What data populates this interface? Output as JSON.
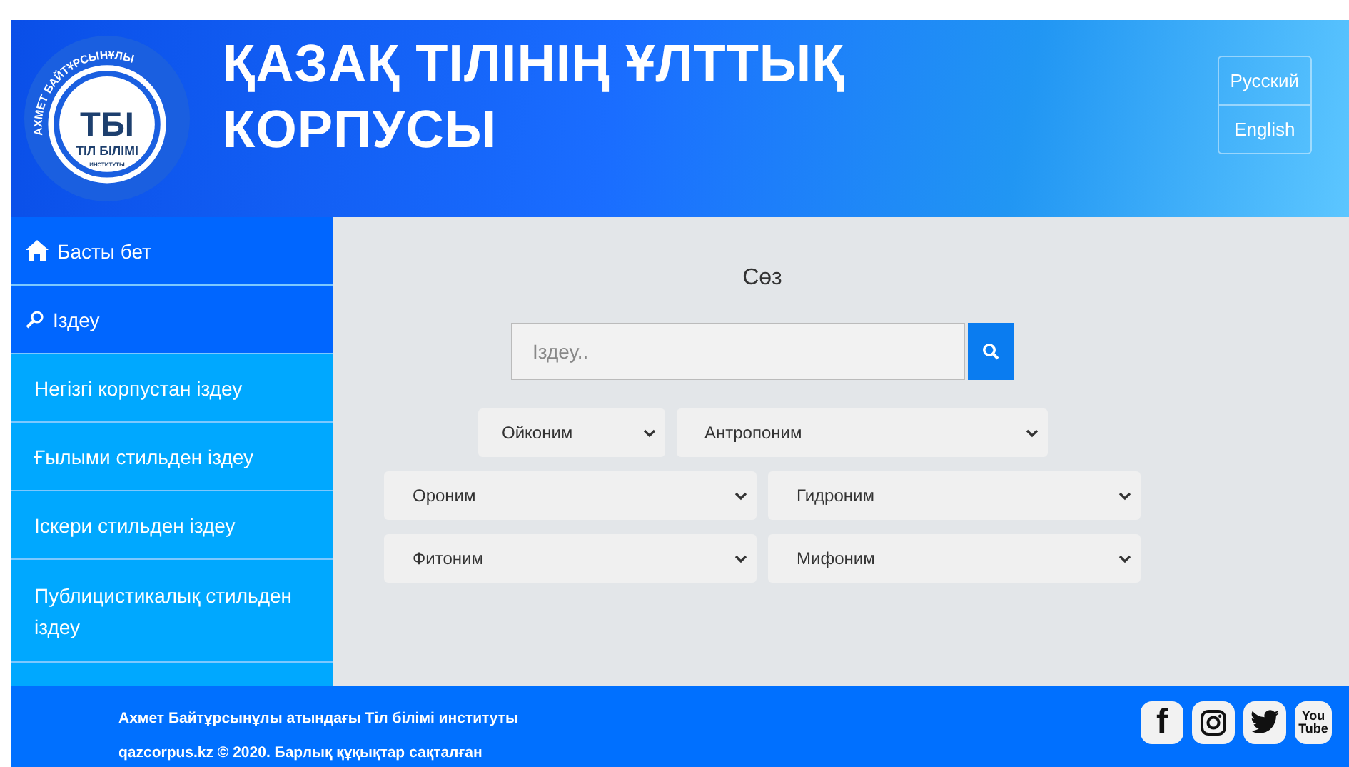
{
  "header": {
    "logo": {
      "arc_text": "АХМЕТ БАЙТҰРСЫНҰЛЫ",
      "mark": "ТБІ",
      "name": "ТІЛ БІЛІМІ",
      "subtitle": "ИНСТИТУТЫ"
    },
    "title": "ҚАЗАҚ ТІЛІНІҢ ҰЛТТЫҚ КОРПУСЫ",
    "languages": [
      {
        "label": "Русский"
      },
      {
        "label": "English"
      }
    ]
  },
  "sidebar": {
    "items": [
      {
        "label": "Басты бет",
        "kind": "home"
      },
      {
        "label": "Іздеу",
        "kind": "search"
      },
      {
        "label": "Негізгі корпустан іздеу",
        "kind": "sub"
      },
      {
        "label": "Ғылыми стильден іздеу",
        "kind": "sub"
      },
      {
        "label": "Іскери стильден іздеу",
        "kind": "sub"
      },
      {
        "label": "Публицистикалық стильден іздеу",
        "kind": "sub"
      }
    ]
  },
  "search": {
    "heading": "Сөз",
    "placeholder": "Іздеу.."
  },
  "filters": [
    [
      {
        "value": "Ойконим"
      },
      {
        "value": "Антропоним"
      }
    ],
    [
      {
        "value": "Ороним"
      },
      {
        "value": "Гидроним"
      }
    ],
    [
      {
        "value": "Фитоним"
      },
      {
        "value": "Мифоним"
      }
    ]
  ],
  "footer": {
    "lines": [
      "Ахмет Байтұрсынұлы атындағы Тіл білімі институты",
      "qazcorpus.kz © 2020. Барлық құқықтар сақталған"
    ],
    "social": [
      {
        "kind": "facebook",
        "glyph": "f"
      },
      {
        "kind": "instagram"
      },
      {
        "kind": "twitter"
      },
      {
        "kind": "youtube",
        "glyph": "You Tube"
      }
    ]
  }
}
